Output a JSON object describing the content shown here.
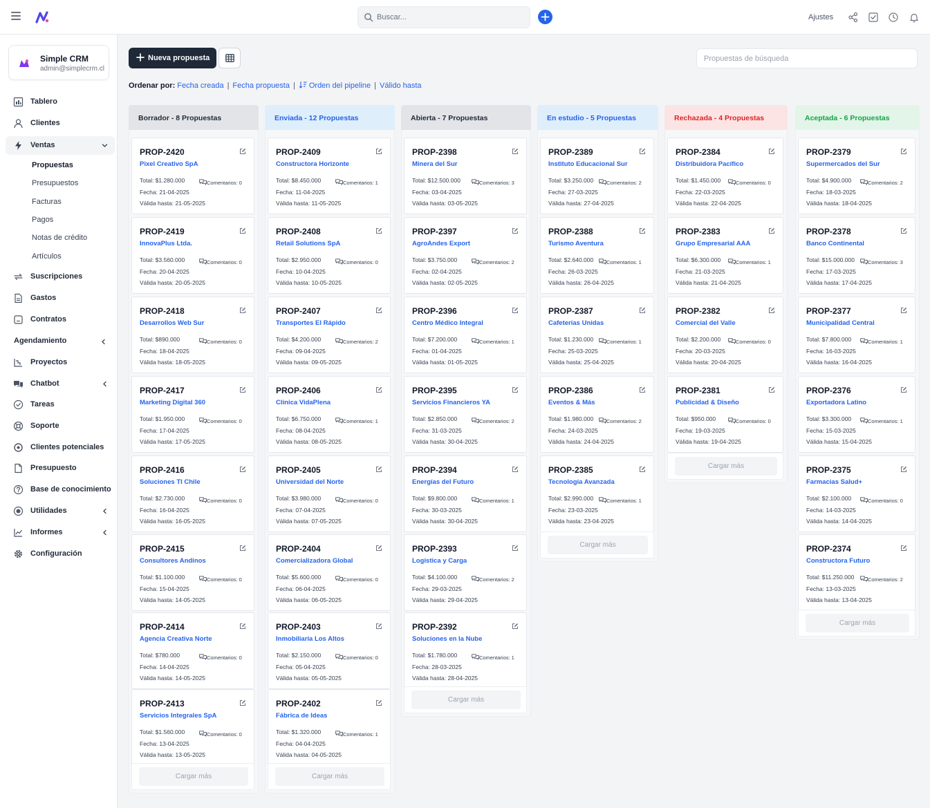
{
  "app": {
    "search_placeholder": "Buscar...",
    "settings_label": "Ajustes",
    "accent_color": "#2563eb"
  },
  "account": {
    "name": "Simple CRM",
    "email": "admin@simplecrm.cl"
  },
  "nav": {
    "tablero": "Tablero",
    "clientes": "Clientes",
    "ventas": "Ventas",
    "ventas_sub": [
      "Propuestas",
      "Presupuestos",
      "Facturas",
      "Pagos",
      "Notas de crédito",
      "Artículos"
    ],
    "suscripciones": "Suscripciones",
    "gastos": "Gastos",
    "contratos": "Contratos",
    "agendamiento": "Agendamiento",
    "proyectos": "Proyectos",
    "chatbot": "Chatbot",
    "tareas": "Tareas",
    "soporte": "Soporte",
    "clientes_potenciales": "Clientes potenciales",
    "presupuesto": "Presupuesto",
    "base_conocimiento": "Base de conocimiento",
    "utilidades": "Utilidades",
    "informes": "Informes",
    "configuracion": "Configuración"
  },
  "toolbar": {
    "new_label": "Nueva propuesta",
    "search_placeholder": "Propuestas de búsqueda",
    "sort_label": "Ordenar por:",
    "sort_created": "Fecha creada",
    "sort_proposal_date": "Fecha propuesta",
    "sort_pipeline": "Orden del pipeline",
    "sort_valid": "Válido hasta"
  },
  "load_more": "Cargar más",
  "columns": [
    {
      "title": "Borrador - 8 Propuestas",
      "color": "#1f2937",
      "bg": "#e2e4e8",
      "cards": [
        {
          "id": "PROP-2420",
          "client": "Pixel Creativo SpA",
          "total": "Total: $1.280.000",
          "comments": "Comentarios: 0",
          "date": "Fecha: 21-04-2025",
          "valid": "Válida hasta: 21-05-2025"
        },
        {
          "id": "PROP-2419",
          "client": "InnovaPlus Ltda.",
          "total": "Total: $3.560.000",
          "comments": "Comentarios: 0",
          "date": "Fecha: 20-04-2025",
          "valid": "Válida hasta: 20-05-2025"
        },
        {
          "id": "PROP-2418",
          "client": "Desarrollos Web Sur",
          "total": "Total: $890.000",
          "comments": "Comentarios: 0",
          "date": "Fecha: 18-04-2025",
          "valid": "Válida hasta: 18-05-2025"
        },
        {
          "id": "PROP-2417",
          "client": "Marketing Digital 360",
          "total": "Total: $1.950.000",
          "comments": "Comentarios: 0",
          "date": "Fecha: 17-04-2025",
          "valid": "Válida hasta: 17-05-2025"
        },
        {
          "id": "PROP-2416",
          "client": "Soluciones TI Chile",
          "total": "Total: $2.730.000",
          "comments": "Comentarios: 0",
          "date": "Fecha: 16-04-2025",
          "valid": "Válida hasta: 16-05-2025"
        },
        {
          "id": "PROP-2415",
          "client": "Consultores Andinos",
          "total": "Total: $1.100.000",
          "comments": "Comentarios: 0",
          "date": "Fecha: 15-04-2025",
          "valid": "Válida hasta: 14-05-2025"
        },
        {
          "id": "PROP-2414",
          "client": "Agencia Creativa Norte",
          "total": "Total: $780.000",
          "comments": "Comentarios: 0",
          "date": "Fecha: 14-04-2025",
          "valid": "Válida hasta: 14-05-2025"
        },
        {
          "id": "PROP-2413",
          "client": "Servicios Integrales SpA",
          "total": "Total: $1.560.000",
          "comments": "Comentarios: 0",
          "date": "Fecha: 13-04-2025",
          "valid": "Válida hasta: 13-05-2025"
        }
      ]
    },
    {
      "title": "Enviada - 12 Propuestas",
      "color": "#2563eb",
      "bg": "#dfeefb",
      "cards": [
        {
          "id": "PROP-2409",
          "client": "Constructora Horizonte",
          "total": "Total: $8.450.000",
          "comments": "Comentarios: 1",
          "date": "Fecha: 11-04-2025",
          "valid": "Válida hasta: 11-05-2025"
        },
        {
          "id": "PROP-2408",
          "client": "Retail Solutions SpA",
          "total": "Total: $2.950.000",
          "comments": "Comentarios: 0",
          "date": "Fecha: 10-04-2025",
          "valid": "Válida hasta: 10-05-2025"
        },
        {
          "id": "PROP-2407",
          "client": "Transportes El Rápido",
          "total": "Total: $4.200.000",
          "comments": "Comentarios: 2",
          "date": "Fecha: 09-04-2025",
          "valid": "Válida hasta: 09-05-2025"
        },
        {
          "id": "PROP-2406",
          "client": "Clínica VidaPlena",
          "total": "Total: $6.750.000",
          "comments": "Comentarios: 1",
          "date": "Fecha: 08-04-2025",
          "valid": "Válida hasta: 08-05-2025"
        },
        {
          "id": "PROP-2405",
          "client": "Universidad del Norte",
          "total": "Total: $3.980.000",
          "comments": "Comentarios: 0",
          "date": "Fecha: 07-04-2025",
          "valid": "Válida hasta: 07-05-2025"
        },
        {
          "id": "PROP-2404",
          "client": "Comercializadora Global",
          "total": "Total: $5.600.000",
          "comments": "Comentarios: 0",
          "date": "Fecha: 06-04-2025",
          "valid": "Válida hasta: 06-05-2025"
        },
        {
          "id": "PROP-2403",
          "client": "Inmobiliaria Los Altos",
          "total": "Total: $2.150.000",
          "comments": "Comentarios: 0",
          "date": "Fecha: 05-04-2025",
          "valid": "Válida hasta: 05-05-2025"
        },
        {
          "id": "PROP-2402",
          "client": "Fábrica de Ideas",
          "total": "Total: $1.320.000",
          "comments": "Comentarios: 1",
          "date": "Fecha: 04-04-2025",
          "valid": "Válida hasta: 04-05-2025"
        }
      ]
    },
    {
      "title": "Abierta - 7 Propuestas",
      "color": "#1f2937",
      "bg": "#e2e4e8",
      "cards": [
        {
          "id": "PROP-2398",
          "client": "Minera del Sur",
          "total": "Total: $12.500.000",
          "comments": "Comentarios: 3",
          "date": "Fecha: 03-04-2025",
          "valid": "Válida hasta: 03-05-2025"
        },
        {
          "id": "PROP-2397",
          "client": "AgroAndes Export",
          "total": "Total: $3.750.000",
          "comments": "Comentarios: 2",
          "date": "Fecha: 02-04-2025",
          "valid": "Válida hasta: 02-05-2025"
        },
        {
          "id": "PROP-2396",
          "client": "Centro Médico Integral",
          "total": "Total: $7.200.000",
          "comments": "Comentarios: 1",
          "date": "Fecha: 01-04-2025",
          "valid": "Válida hasta: 01-05-2025"
        },
        {
          "id": "PROP-2395",
          "client": "Servicios Financieros YA",
          "total": "Total: $2.850.000",
          "comments": "Comentarios: 2",
          "date": "Fecha: 31-03-2025",
          "valid": "Válida hasta: 30-04-2025"
        },
        {
          "id": "PROP-2394",
          "client": "Energías del Futuro",
          "total": "Total: $9.800.000",
          "comments": "Comentarios: 1",
          "date": "Fecha: 30-03-2025",
          "valid": "Válida hasta: 30-04-2025"
        },
        {
          "id": "PROP-2393",
          "client": "Logística y Carga",
          "total": "Total: $4.100.000",
          "comments": "Comentarios: 2",
          "date": "Fecha: 29-03-2025",
          "valid": "Válida hasta: 29-04-2025"
        },
        {
          "id": "PROP-2392",
          "client": "Soluciones en la Nube",
          "total": "Total: $1.780.000",
          "comments": "Comentarios: 1",
          "date": "Fecha: 28-03-2025",
          "valid": "Válida hasta: 28-04-2025"
        }
      ]
    },
    {
      "title": "En estudio - 5 Propuestas",
      "color": "#2563eb",
      "bg": "#dfeefb",
      "cards": [
        {
          "id": "PROP-2389",
          "client": "Instituto Educacional Sur",
          "total": "Total: $3.250.000",
          "comments": "Comentarios: 2",
          "date": "Fecha: 27-03-2025",
          "valid": "Válida hasta: 27-04-2025"
        },
        {
          "id": "PROP-2388",
          "client": "Turismo Aventura",
          "total": "Total: $2.640.000",
          "comments": "Comentarios: 1",
          "date": "Fecha: 26-03-2025",
          "valid": "Válida hasta: 26-04-2025"
        },
        {
          "id": "PROP-2387",
          "client": "Cafeterías Unidas",
          "total": "Total: $1.230.000",
          "comments": "Comentarios: 1",
          "date": "Fecha: 25-03-2025",
          "valid": "Válida hasta: 25-04-2025"
        },
        {
          "id": "PROP-2386",
          "client": "Eventos & Más",
          "total": "Total: $1.980.000",
          "comments": "Comentarios: 2",
          "date": "Fecha: 24-03-2025",
          "valid": "Válida hasta: 24-04-2025"
        },
        {
          "id": "PROP-2385",
          "client": "Tecnología Avanzada",
          "total": "Total: $2.990.000",
          "comments": "Comentarios: 1",
          "date": "Fecha: 23-03-2025",
          "valid": "Válida hasta: 23-04-2025"
        }
      ]
    },
    {
      "title": "Rechazada - 4 Propuestas",
      "color": "#dc2626",
      "bg": "#fce4e4",
      "cards": [
        {
          "id": "PROP-2384",
          "client": "Distribuidora Pacífico",
          "total": "Total: $1.450.000",
          "comments": "Comentarios: 0",
          "date": "Fecha: 22-03-2025",
          "valid": "Válida hasta: 22-04-2025"
        },
        {
          "id": "PROP-2383",
          "client": "Grupo Empresarial AAA",
          "total": "Total: $6.300.000",
          "comments": "Comentarios: 1",
          "date": "Fecha: 21-03-2025",
          "valid": "Válida hasta: 21-04-2025"
        },
        {
          "id": "PROP-2382",
          "client": "Comercial del Valle",
          "total": "Total: $2.200.000",
          "comments": "Comentarios: 0",
          "date": "Fecha: 20-03-2025",
          "valid": "Válida hasta: 20-04-2025"
        },
        {
          "id": "PROP-2381",
          "client": "Publicidad & Diseño",
          "total": "Total: $950.000",
          "comments": "Comentarios: 0",
          "date": "Fecha: 19-03-2025",
          "valid": "Válida hasta: 19-04-2025"
        }
      ]
    },
    {
      "title": "Aceptada - 6 Propuestas",
      "color": "#16a34a",
      "bg": "#e2f5e8",
      "cards": [
        {
          "id": "PROP-2379",
          "client": "Supermercados del Sur",
          "total": "Total: $4.900.000",
          "comments": "Comentarios: 2",
          "date": "Fecha: 18-03-2025",
          "valid": "Válida hasta: 18-04-2025"
        },
        {
          "id": "PROP-2378",
          "client": "Banco Continental",
          "total": "Total: $15.000.000",
          "comments": "Comentarios: 3",
          "date": "Fecha: 17-03-2025",
          "valid": "Válida hasta: 17-04-2025"
        },
        {
          "id": "PROP-2377",
          "client": "Municipalidad Central",
          "total": "Total: $7.800.000",
          "comments": "Comentarios: 1",
          "date": "Fecha: 16-03-2025",
          "valid": "Válida hasta: 16-04-2025"
        },
        {
          "id": "PROP-2376",
          "client": "Exportadora Latino",
          "total": "Total: $3.300.000",
          "comments": "Comentarios: 1",
          "date": "Fecha: 15-03-2025",
          "valid": "Válida hasta: 15-04-2025"
        },
        {
          "id": "PROP-2375",
          "client": "Farmacias Salud+",
          "total": "Total: $2.100.000",
          "comments": "Comentarios: 0",
          "date": "Fecha: 14-03-2025",
          "valid": "Válida hasta: 14-04-2025"
        },
        {
          "id": "PROP-2374",
          "client": "Constructora Futuro",
          "total": "Total: $11.250.000",
          "comments": "Comentarios: 2",
          "date": "Fecha: 13-03-2025",
          "valid": "Válida hasta: 13-04-2025"
        }
      ]
    }
  ]
}
